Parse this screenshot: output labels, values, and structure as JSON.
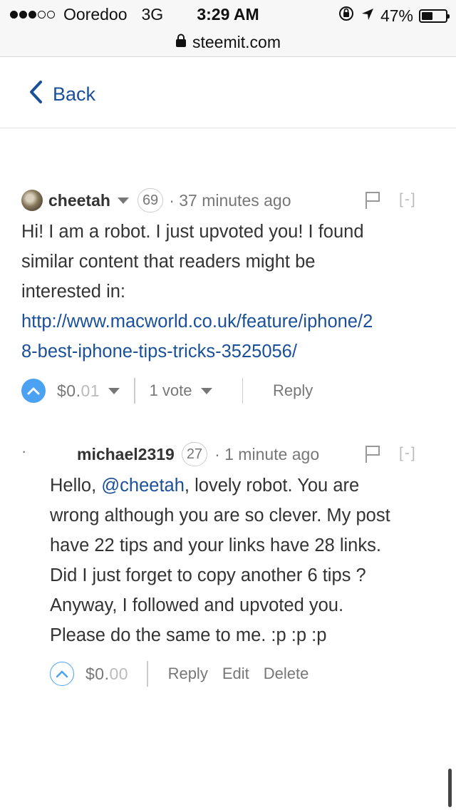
{
  "status_bar": {
    "carrier": "Ooredoo",
    "network": "3G",
    "time": "3:29 AM",
    "battery": "47%",
    "battery_level": 0.47,
    "signal_bars_filled": 3,
    "signal_bars_total": 5
  },
  "url_bar": {
    "domain": "steemit.com"
  },
  "nav": {
    "back_label": "Back"
  },
  "comments": [
    {
      "author": "cheetah",
      "reputation": "69",
      "age": "· 37 minutes ago",
      "collapse": "[-]",
      "body_lines": [
        "Hi! I am a robot. I just upvoted you! I found",
        "similar content that readers might be",
        "interested in:"
      ],
      "link_lines": [
        "http://www.macworld.co.uk/feature/iphone/2",
        "8-best-iphone-tips-tricks-3525056/"
      ],
      "payout_dollar": "$0.",
      "payout_cents": "01",
      "votes": "1 vote",
      "reply_label": "Reply",
      "upvoted": true
    },
    {
      "author": "michael2319",
      "reputation": "27",
      "age": "· 1 minute ago",
      "collapse": "[-]",
      "bullet": "·",
      "body_prefix": "Hello, ",
      "mention": "@cheetah",
      "body_first_rest": ", lovely robot. You are",
      "body_lines": [
        "wrong although you are so clever. My post",
        "have 22 tips and your links have 28 links.",
        "Did I just forget to copy another 6 tips ?",
        "Anyway, I followed and upvoted you.",
        "Please do the same to me. :p :p :p"
      ],
      "payout_dollar": "$0.",
      "payout_cents": "00",
      "reply_label": "Reply",
      "edit_label": "Edit",
      "delete_label": "Delete",
      "upvoted": false
    }
  ],
  "colors": {
    "link": "#1a5099",
    "upvote_active": "#4ba2f2",
    "muted_text": "#777777",
    "body_text": "#333333"
  }
}
